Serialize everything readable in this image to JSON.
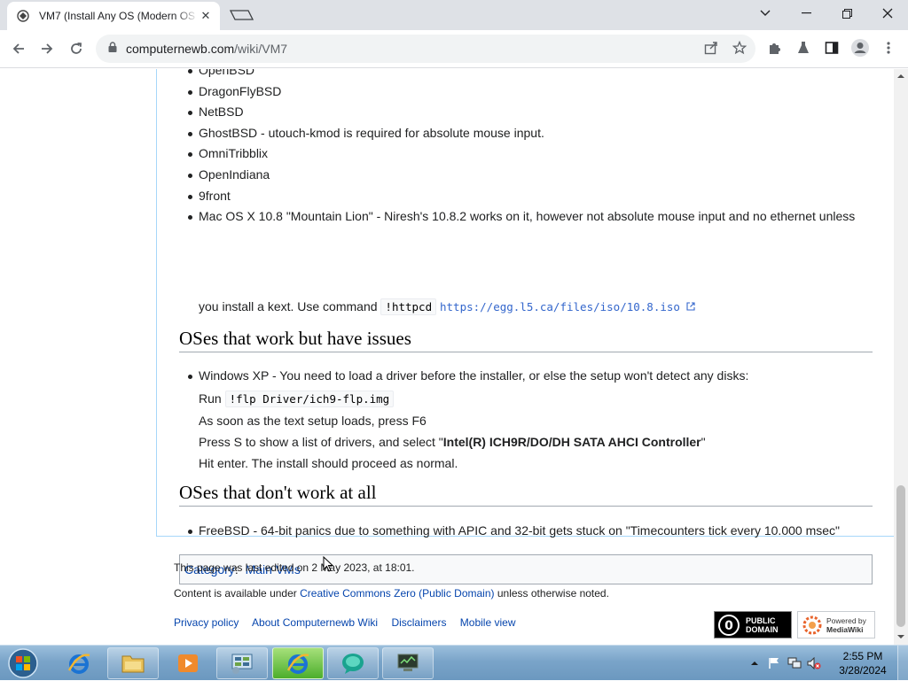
{
  "browser": {
    "tab_title": "VM7 (Install Any OS (Modern OS",
    "url_host": "computernewb.com",
    "url_path": "/wiki/VM7"
  },
  "article": {
    "supported_items": [
      "OpenBSD",
      "DragonFlyBSD",
      "NetBSD",
      "GhostBSD - utouch-kmod is required for absolute mouse input.",
      "OmniTribblix",
      "OpenIndiana",
      "9front"
    ],
    "mac_item_line1": "Mac OS X 10.8 \"Mountain Lion\" - Niresh's 10.8.2 works on it, however not absolute mouse input and no ethernet unless",
    "mac_item_line2_prefix": "you install a kext. Use command",
    "mac_command": "!httpcd",
    "mac_link": "https://egg.l5.ca/files/iso/10.8.iso",
    "issues_heading": "OSes that work but have issues",
    "winxp_line": "Windows XP - You need to load a driver before the installer, or else the setup won't detect any disks:",
    "run_label": "Run",
    "run_command": "!flp Driver/ich9-flp.img",
    "step_f6": "As soon as the text setup loads, press F6",
    "step_s_prefix": "Press S to show a list of drivers, and select \"",
    "step_s_bold": "Intel(R) ICH9R/DO/DH SATA AHCI Controller",
    "step_s_suffix": "\"",
    "step_enter": "Hit enter. The install should proceed as normal.",
    "nowork_heading": "OSes that don't work at all",
    "freebsd_line": "FreeBSD - 64-bit panics due to something with APIC and 32-bit gets stuck on \"Timecounters tick every 10.000 msec\"",
    "category_label": "Category",
    "category_value": "Main VMs"
  },
  "footer": {
    "last_edited": "This page was last edited on 2 May 2023, at 18:01.",
    "license_prefix": "Content is available under",
    "license_link": "Creative Commons Zero (Public Domain)",
    "license_suffix": "unless otherwise noted.",
    "links": [
      "Privacy policy",
      "About Computernewb Wiki",
      "Disclaimers",
      "Mobile view"
    ],
    "badge_pd_line1": "PUBLIC",
    "badge_pd_line2": "DOMAIN",
    "badge_mw_line1": "Powered by",
    "badge_mw_line2": "MediaWiki"
  },
  "taskbar": {
    "time": "2:55 PM",
    "date": "3/28/2024"
  },
  "icons": {
    "tab_favicon": "wiki-favicon-icon",
    "back": "arrow-left-icon",
    "forward": "arrow-right-icon",
    "reload": "reload-icon",
    "lock": "lock-icon",
    "share": "share-icon",
    "bookmark": "star-icon",
    "extensions": "puzzle-icon",
    "profile": "avatar-icon",
    "menu": "kebab-menu-icon"
  }
}
